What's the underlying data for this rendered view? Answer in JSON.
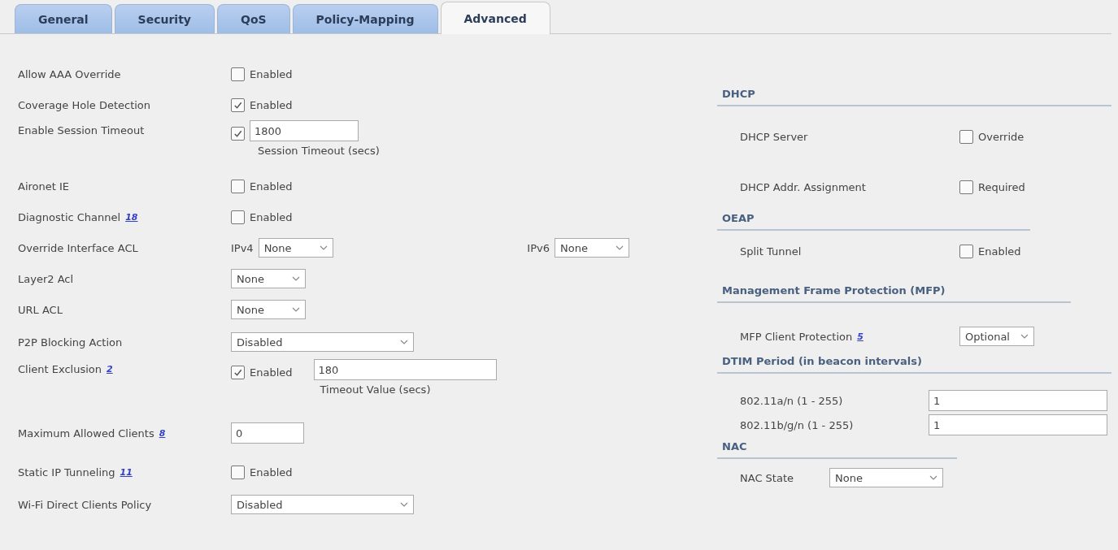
{
  "tabs": [
    {
      "label": "General",
      "selected": false
    },
    {
      "label": "Security",
      "selected": false
    },
    {
      "label": "QoS",
      "selected": false
    },
    {
      "label": "Policy-Mapping",
      "selected": false
    },
    {
      "label": "Advanced",
      "selected": true
    }
  ],
  "left_settings": [
    {
      "kind": "checkbox",
      "label": "Allow AAA Override",
      "checked": false,
      "text": "Enabled"
    },
    {
      "kind": "checkbox",
      "label": "Coverage Hole Detection",
      "checked": true,
      "text": "Enabled"
    },
    {
      "kind": "checkbox_field",
      "label": "Enable Session Timeout",
      "checked": true,
      "value": "1800",
      "caption": "Session Timeout (secs)"
    },
    {
      "kind": "checkbox",
      "label": "Aironet IE",
      "checked": false,
      "text": "Enabled"
    },
    {
      "kind": "checkbox",
      "label": "Diagnostic Channel",
      "help": "18",
      "checked": false,
      "text": "Enabled"
    },
    {
      "kind": "acl",
      "label": "Override Interface ACL",
      "selects": [
        {
          "prefix": "IPv4",
          "value": "None"
        },
        {
          "prefix": "IPv6",
          "value": "None"
        }
      ]
    },
    {
      "kind": "select",
      "label": "Layer2 Acl",
      "value": "None"
    },
    {
      "kind": "select",
      "label": "URL ACL",
      "value": "None"
    },
    {
      "kind": "wide_select",
      "label": "P2P Blocking Action",
      "value": "Disabled"
    },
    {
      "kind": "checkbox_field",
      "label": "Client Exclusion",
      "help": "2",
      "checked": true,
      "text": "Enabled",
      "value": "180",
      "caption": "Timeout Value (secs)"
    },
    {
      "kind": "input",
      "label": "Maximum Allowed Clients",
      "help": "8",
      "value": "0"
    },
    {
      "kind": "checkbox",
      "label": "Static IP Tunneling",
      "help": "11",
      "checked": false,
      "text": "Enabled"
    },
    {
      "kind": "wide_select",
      "label": "Wi-Fi Direct Clients Policy",
      "value": "Disabled"
    }
  ],
  "right_sections": [
    {
      "heading": "DHCP",
      "rows": [
        {
          "kind": "checkbox",
          "label": "DHCP Server",
          "checked": false,
          "text": "Override"
        },
        {
          "kind": "checkbox",
          "label": "DHCP Addr. Assignment",
          "checked": false,
          "text": "Required"
        }
      ]
    },
    {
      "heading": "OEAP",
      "rows": [
        {
          "kind": "checkbox",
          "label": "Split Tunnel",
          "checked": false,
          "text": "Enabled"
        }
      ]
    },
    {
      "heading": "Management Frame Protection (MFP)",
      "rows": [
        {
          "kind": "select",
          "label": "MFP Client Protection",
          "help": "5",
          "value": "Optional"
        }
      ]
    },
    {
      "heading": "DTIM Period (in beacon intervals)",
      "rows": [
        {
          "kind": "input",
          "label": "802.11a/n (1 - 255)",
          "value": "1"
        },
        {
          "kind": "input",
          "label": "802.11b/g/n (1 - 255)",
          "value": "1"
        }
      ]
    },
    {
      "heading": "NAC",
      "rows": [
        {
          "kind": "select",
          "label": "NAC State",
          "value": "None"
        }
      ]
    }
  ]
}
